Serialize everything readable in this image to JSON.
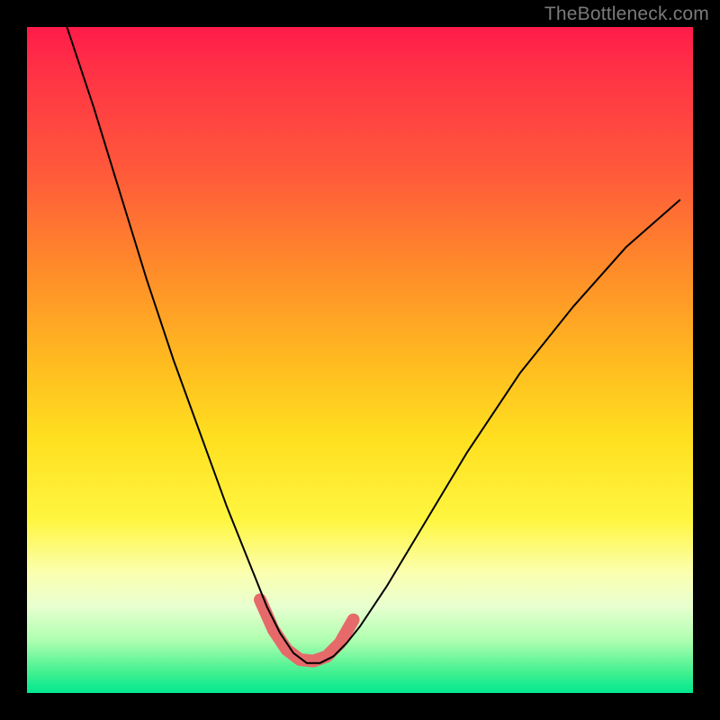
{
  "watermark": "TheBottleneck.com",
  "chart_data": {
    "type": "line",
    "title": "",
    "xlabel": "",
    "ylabel": "",
    "xlim": [
      0,
      100
    ],
    "ylim": [
      0,
      100
    ],
    "note": "Axes are unlabeled; values are approximate percentages of plot width/height read from the image. The plotted curve is a V-shaped bottleneck curve with a rounded minimum near x≈42, plus a short highlighted (thick pink) segment around the trough.",
    "series": [
      {
        "name": "bottleneck-curve",
        "color": "#000000",
        "stroke_width": 2,
        "x": [
          6,
          10,
          14,
          18,
          22,
          26,
          30,
          34,
          36,
          38,
          40,
          42,
          44,
          46,
          48,
          50,
          54,
          60,
          66,
          74,
          82,
          90,
          98
        ],
        "y": [
          100,
          88,
          75,
          62,
          50,
          39,
          28,
          18,
          13,
          9,
          6,
          4.5,
          4.5,
          5.5,
          7.5,
          10,
          16,
          26,
          36,
          48,
          58,
          67,
          74
        ]
      },
      {
        "name": "trough-highlight",
        "color": "#e66a6a",
        "stroke_width": 14,
        "x": [
          35,
          37,
          39,
          41,
          43,
          45,
          47,
          49
        ],
        "y": [
          14,
          9.5,
          6.5,
          5,
          4.8,
          5.5,
          7.5,
          11
        ]
      }
    ]
  }
}
